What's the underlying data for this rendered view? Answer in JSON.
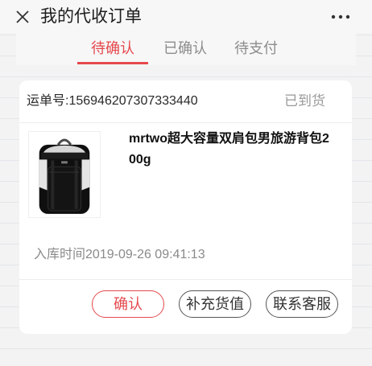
{
  "icons": {
    "close": "close-icon",
    "more": "more-icon",
    "product": "backpack-image"
  },
  "colors": {
    "accent": "#e5484d",
    "page_background": "#f3f3f3",
    "card_background": "#ffffff",
    "muted_text": "#999999"
  },
  "header": {
    "title": "我的代收订单"
  },
  "tabs": [
    {
      "label": "待确认",
      "active": true
    },
    {
      "label": "已确认",
      "active": false
    },
    {
      "label": "待支付",
      "active": false
    }
  ],
  "order": {
    "waybill_label": "运单号:",
    "waybill_number": "156946207307333440",
    "status": "已到货",
    "product": {
      "title": "mrtwo超大容量双肩包男旅游背包200g"
    },
    "inbound_label": "入库时间",
    "inbound_time": "2019-09-26 09:41:13",
    "actions": [
      {
        "label": "确认",
        "primary": true
      },
      {
        "label": "补充货值",
        "primary": false
      },
      {
        "label": "联系客服",
        "primary": false
      }
    ]
  }
}
